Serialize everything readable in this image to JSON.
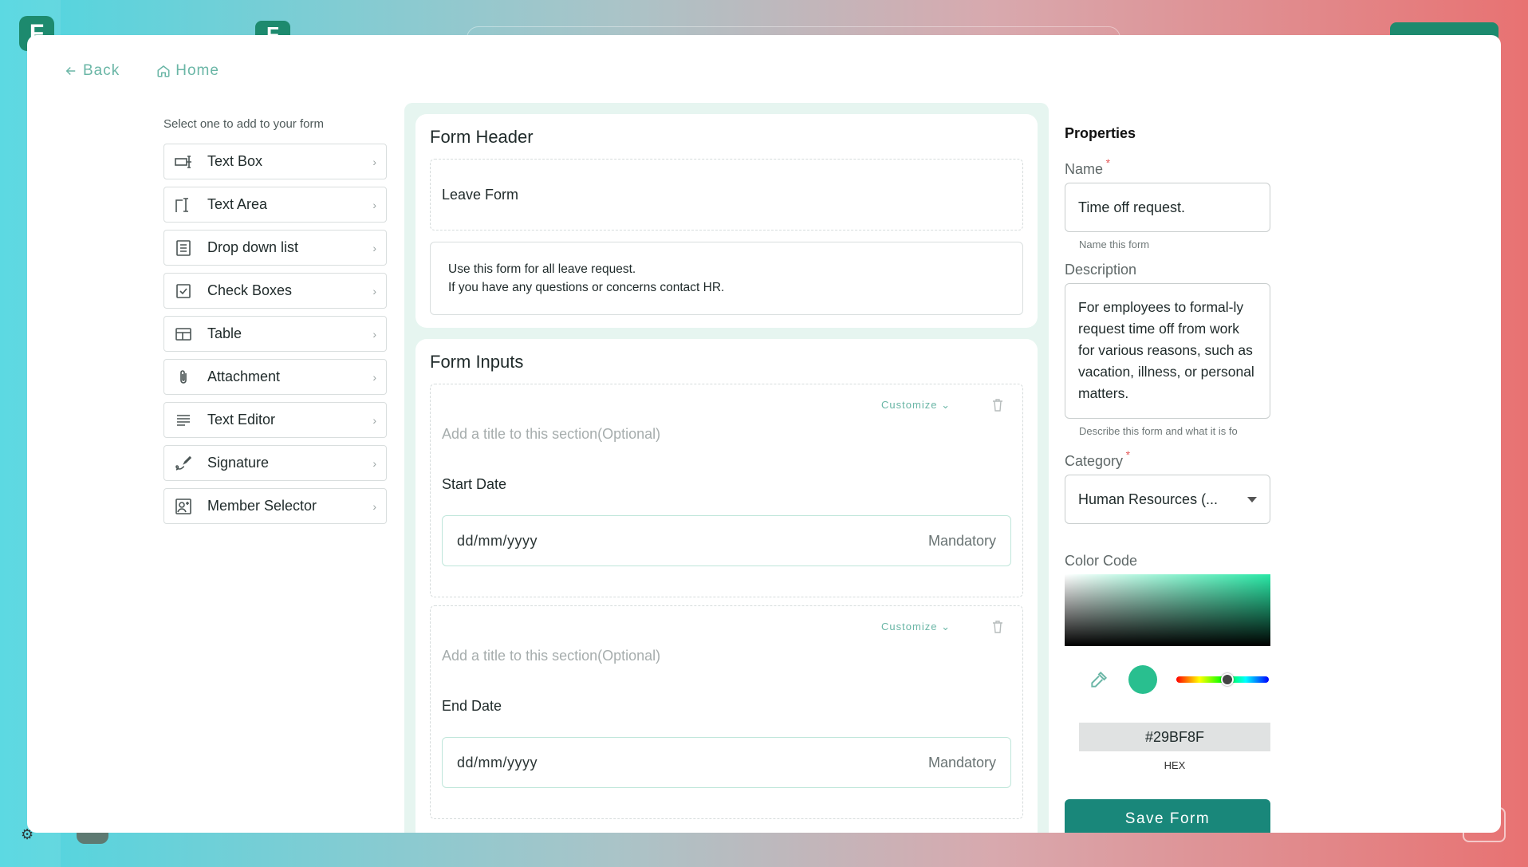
{
  "nav": {
    "back_label": "Back",
    "home_label": "Home"
  },
  "palette": {
    "hint": "Select one to add to your form",
    "items": [
      {
        "label": "Text Box",
        "icon": "text-box-icon"
      },
      {
        "label": "Text Area",
        "icon": "text-area-icon"
      },
      {
        "label": "Drop down list",
        "icon": "dropdown-list-icon"
      },
      {
        "label": "Check Boxes",
        "icon": "checkbox-icon"
      },
      {
        "label": "Table",
        "icon": "table-icon"
      },
      {
        "label": "Attachment",
        "icon": "paperclip-icon"
      },
      {
        "label": "Text Editor",
        "icon": "text-editor-icon"
      },
      {
        "label": "Signature",
        "icon": "signature-icon"
      },
      {
        "label": "Member Selector",
        "icon": "member-selector-icon"
      }
    ]
  },
  "form_header": {
    "title": "Form Header",
    "name": "Leave Form",
    "description_line1": "Use this form for all leave request.",
    "description_line2": "If you have any questions or concerns contact HR."
  },
  "form_inputs": {
    "title": "Form Inputs",
    "sections": [
      {
        "customize_label": "Customize",
        "title_placeholder": "Add a title to this section(Optional)",
        "field_label": "Start Date",
        "input_placeholder": "dd/mm/yyyy",
        "mandatory_label": "Mandatory"
      },
      {
        "customize_label": "Customize",
        "title_placeholder": "Add a title to this section(Optional)",
        "field_label": "End Date",
        "input_placeholder": "dd/mm/yyyy",
        "mandatory_label": "Mandatory"
      }
    ]
  },
  "properties": {
    "title": "Properties",
    "name_label": "Name",
    "name_value": "Time off request.",
    "name_helper": "Name this form",
    "description_label": "Description",
    "description_value": "For employees to formal-ly request time off from work for various reasons, such as vacation, illness, or personal matters.",
    "description_helper": "Describe this form and what it is fo",
    "category_label": "Category",
    "category_value": "Human Resources (...",
    "color_label": "Color Code",
    "hex_value": "#29BF8F",
    "hex_label": "HEX",
    "hue_position": 0.55
  },
  "save_label": "Save Form",
  "colors": {
    "accent": "#19877a",
    "selected": "#29BF8F",
    "link": "#6ab6a6"
  }
}
